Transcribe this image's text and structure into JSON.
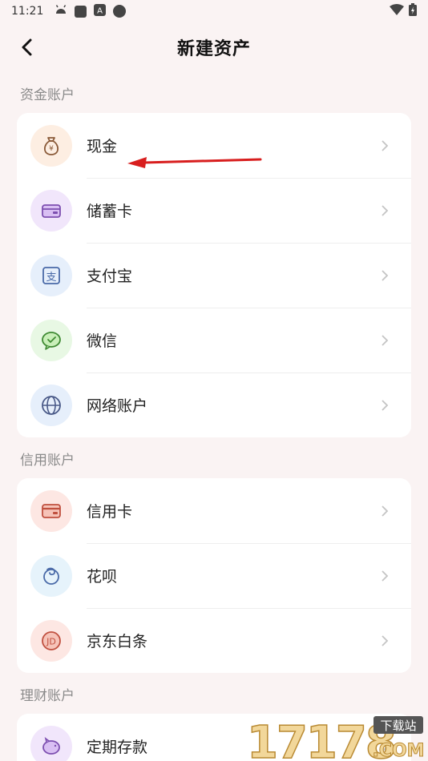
{
  "status": {
    "time": "11:21"
  },
  "header": {
    "title": "新建资产"
  },
  "sections": [
    {
      "title": "资金账户",
      "items": [
        {
          "label": "现金",
          "icon": "money-bag-icon",
          "bg": "#fdeee2",
          "fg": "#b88256"
        },
        {
          "label": "储蓄卡",
          "icon": "wallet-card-icon",
          "bg": "#f1e6fb",
          "fg": "#9a6cc9"
        },
        {
          "label": "支付宝",
          "icon": "alipay-icon",
          "bg": "#e6effb",
          "fg": "#5b7fbf"
        },
        {
          "label": "微信",
          "icon": "wechat-icon",
          "bg": "#e8f8e4",
          "fg": "#5aa84e"
        },
        {
          "label": "网络账户",
          "icon": "globe-icon",
          "bg": "#e6effb",
          "fg": "#5b6fa8"
        }
      ]
    },
    {
      "title": "信用账户",
      "items": [
        {
          "label": "信用卡",
          "icon": "credit-card-icon",
          "bg": "#fde7e3",
          "fg": "#d66e5e"
        },
        {
          "label": "花呗",
          "icon": "huabei-icon",
          "bg": "#e6f3fb",
          "fg": "#5b7fbf"
        },
        {
          "label": "京东白条",
          "icon": "jd-icon",
          "bg": "#fde7e3",
          "fg": "#d66e5e"
        }
      ]
    },
    {
      "title": "理财账户",
      "items": [
        {
          "label": "定期存款",
          "icon": "piggy-bank-icon",
          "bg": "#f1e6fb",
          "fg": "#9a6cc9"
        }
      ]
    }
  ],
  "watermark": {
    "text": "17178",
    "badge": "下载站",
    "suffix": ".COM"
  }
}
